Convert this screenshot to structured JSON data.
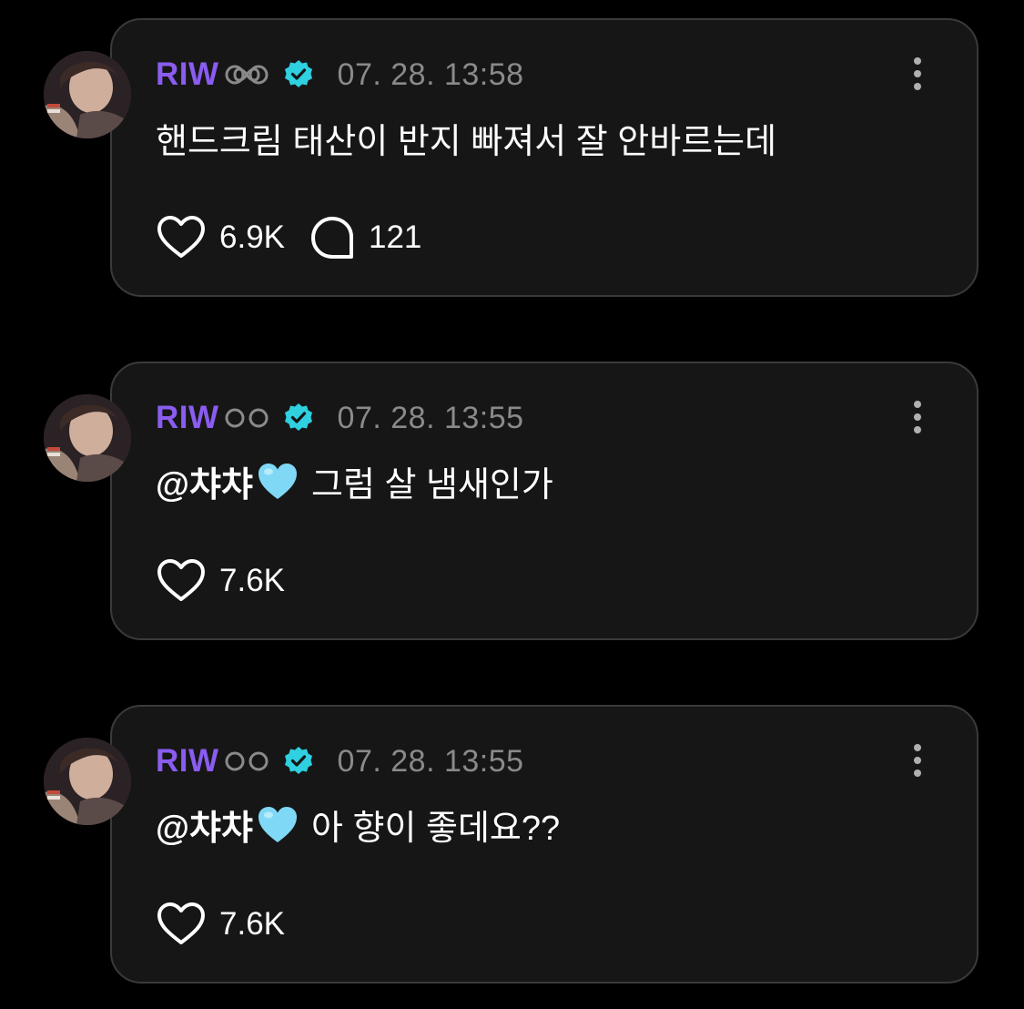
{
  "posts": [
    {
      "username": "RIW",
      "badge_icon": "infinity-icon",
      "verified_icon": "verified-badge-icon",
      "timestamp": "07. 28. 13:58",
      "text": "핸드크림 태산이 반지 빠져서 잘 안바르는데",
      "mention": "",
      "likes": "6.9K",
      "comments": "121"
    },
    {
      "username": "RIW",
      "badge_icon": "infinity-icon",
      "verified_icon": "verified-badge-icon",
      "timestamp": "07. 28. 13:55",
      "mention": "@챠챠",
      "text": "그럼 살 냄새인가",
      "likes": "7.6K"
    },
    {
      "username": "RIW",
      "badge_icon": "infinity-icon",
      "verified_icon": "verified-badge-icon",
      "timestamp": "07. 28. 13:55",
      "mention": "@챠챠",
      "text": "아 향이 좋데요??",
      "likes": "7.6K"
    }
  ],
  "colors": {
    "username": "#8a5cf0",
    "verified": "#2fd0e0",
    "timestamp": "#8a8a8a",
    "card_bg": "#161616",
    "card_border": "#3a3a3a",
    "light_blue_heart": "#7fd8f5"
  }
}
